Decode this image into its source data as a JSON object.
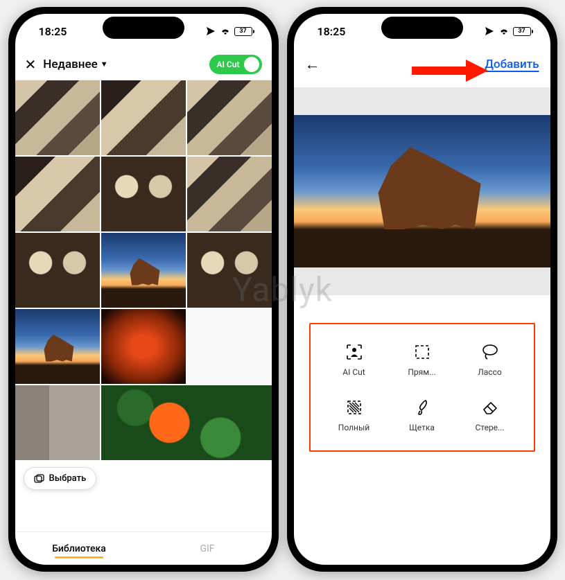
{
  "status": {
    "time": "18:25",
    "battery_percent": "37"
  },
  "phone1": {
    "close_label": "✕",
    "album_title": "Недавнее",
    "ai_cut_label": "AI Cut",
    "select_button": "Выбрать",
    "tabs": {
      "library": "Библиотека",
      "gif": "GIF"
    }
  },
  "phone2": {
    "back_label": "←",
    "add_button": "Добавить",
    "tools": [
      {
        "name": "ai-cut",
        "label": "AI Cut"
      },
      {
        "name": "rect",
        "label": "Прям..."
      },
      {
        "name": "lasso",
        "label": "Лассо"
      },
      {
        "name": "full",
        "label": "Полный"
      },
      {
        "name": "brush",
        "label": "Щетка"
      },
      {
        "name": "eraser",
        "label": "Стере..."
      }
    ]
  },
  "watermark": "Yablyk"
}
